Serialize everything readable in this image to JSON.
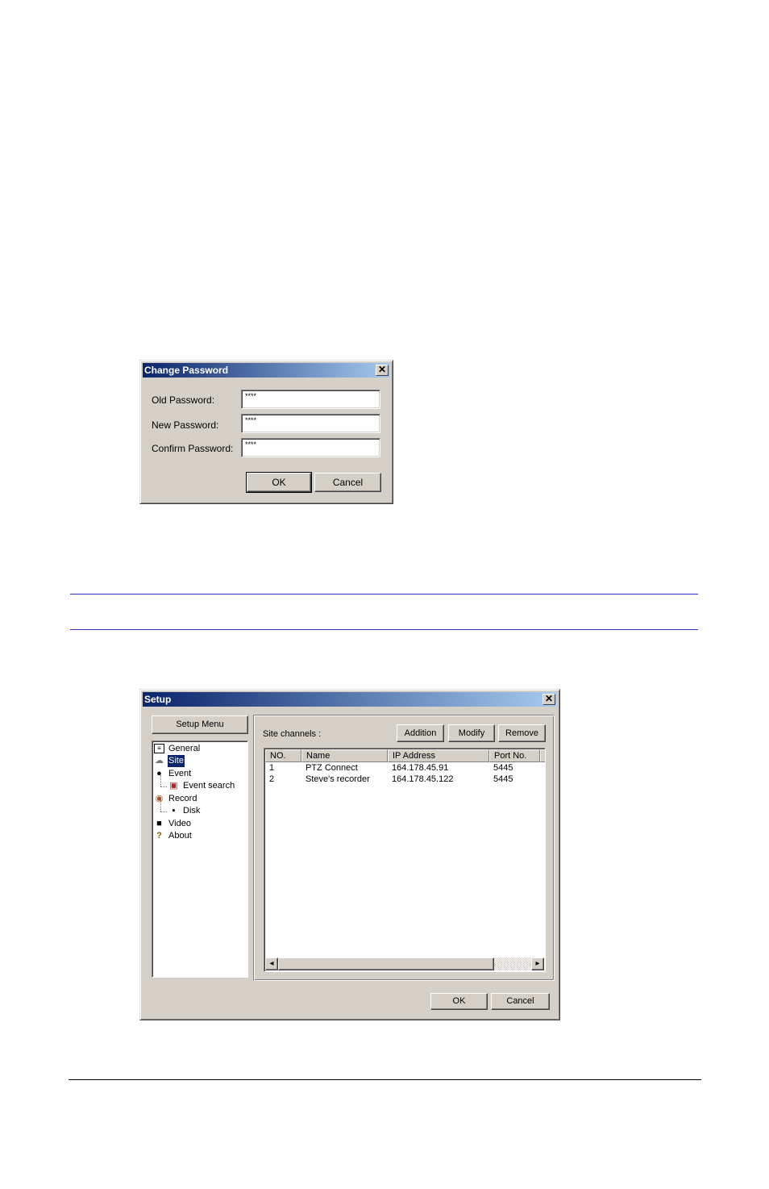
{
  "change_password": {
    "title": "Change Password",
    "old_label": "Old Password:",
    "old_value": "****",
    "new_label": "New Password:",
    "new_value": "****",
    "confirm_label": "Confirm Password:",
    "confirm_value": "****",
    "ok": "OK",
    "cancel": "Cancel",
    "close": "✕"
  },
  "setup": {
    "title": "Setup",
    "close": "✕",
    "menu_header": "Setup Menu",
    "tree": [
      {
        "label": "General",
        "icon": "general-icon"
      },
      {
        "label": "Site",
        "icon": "site-icon",
        "selected": true
      },
      {
        "label": "Event",
        "icon": "event-icon"
      },
      {
        "label": "Event search",
        "icon": "event-search-icon",
        "child": true
      },
      {
        "label": "Record",
        "icon": "record-icon"
      },
      {
        "label": "Disk",
        "icon": "disk-icon",
        "child": true
      },
      {
        "label": "Video",
        "icon": "video-icon"
      },
      {
        "label": "About",
        "icon": "about-icon"
      }
    ],
    "site_channels_label": "Site channels :",
    "addition": "Addition",
    "modify": "Modify",
    "remove": "Remove",
    "columns": [
      "NO.",
      "Name",
      "IP Address",
      "Port No."
    ],
    "rows": [
      [
        "1",
        "PTZ Connect",
        "164.178.45.91",
        "5445"
      ],
      [
        "2",
        "Steve's recorder",
        "164.178.45.122",
        "5445"
      ]
    ],
    "ok": "OK",
    "cancel": "Cancel",
    "scroll_left": "◂",
    "scroll_right": "▸"
  },
  "colors": {
    "titlebar_start": "#0a246a",
    "titlebar_end": "#a6caf0",
    "rule": "#3333cc",
    "face": "#d4d0c8"
  }
}
